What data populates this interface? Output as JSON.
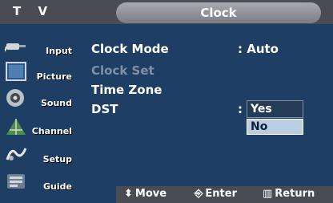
{
  "header": {
    "tv_label": "T V",
    "title": "Clock"
  },
  "sidebar": {
    "items": [
      {
        "label": "Input",
        "icon": "input-plug-icon"
      },
      {
        "label": "Picture",
        "icon": "picture-icon"
      },
      {
        "label": "Sound",
        "icon": "speaker-icon"
      },
      {
        "label": "Channel",
        "icon": "channel-antenna-icon"
      },
      {
        "label": "Setup",
        "icon": "setup-icon"
      },
      {
        "label": "Guide",
        "icon": "guide-icon"
      }
    ]
  },
  "menu": {
    "rows": [
      {
        "label": "Clock Mode",
        "value": ": Auto"
      },
      {
        "label": "Clock Set",
        "value": ""
      },
      {
        "label": "Time Zone",
        "value": ""
      },
      {
        "label": "DST",
        "value": ":"
      }
    ]
  },
  "dropdown": {
    "options": [
      "Yes",
      "No"
    ],
    "selected": "Yes"
  },
  "footer": {
    "move": "Move",
    "enter": "Enter",
    "return": "Return"
  }
}
